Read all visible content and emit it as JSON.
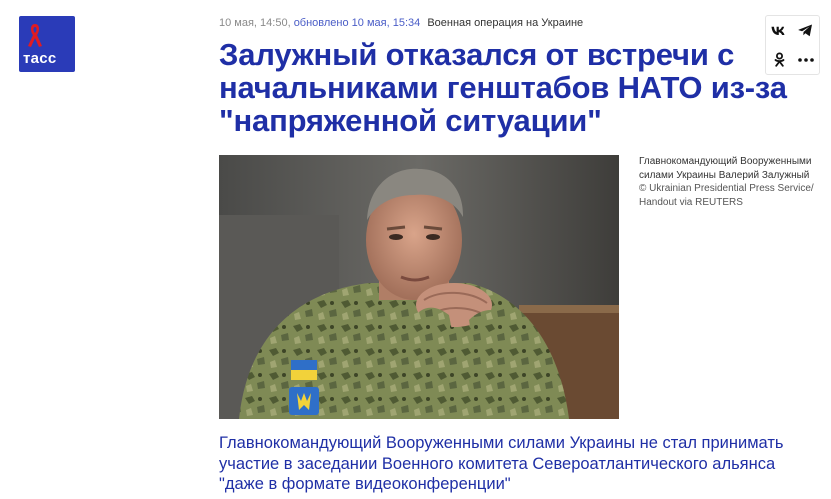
{
  "brand": {
    "logo_text": "тасс",
    "colors": {
      "logo_bg": "#2a3bb8",
      "accent": "#1f2fa6",
      "ribbon": "#e01b22"
    }
  },
  "meta": {
    "published": "10 мая, 14:50,",
    "updated": "обновлено 10 мая, 15:34",
    "rubric": "Военная операция на Украине"
  },
  "headline": "Залужный отказался от встречи с начальниками генштабов НАТО из-за \"напряженной ситуации\"",
  "share": {
    "icons": [
      "vk-icon",
      "telegram-icon",
      "odnoklassniki-icon",
      "more-icon"
    ]
  },
  "photo": {
    "caption": "Главнокомандующий Вооруженными силами Украины Валерий Залужный",
    "credit": "© Ukrainian Presidential Press Service/ Handout via REUTERS"
  },
  "lead": "Главнокомандующий Вооруженными силами Украины не стал принимать участие в заседании Военного комитета Североатлантического альянса \"даже в формате видеоконференции\""
}
